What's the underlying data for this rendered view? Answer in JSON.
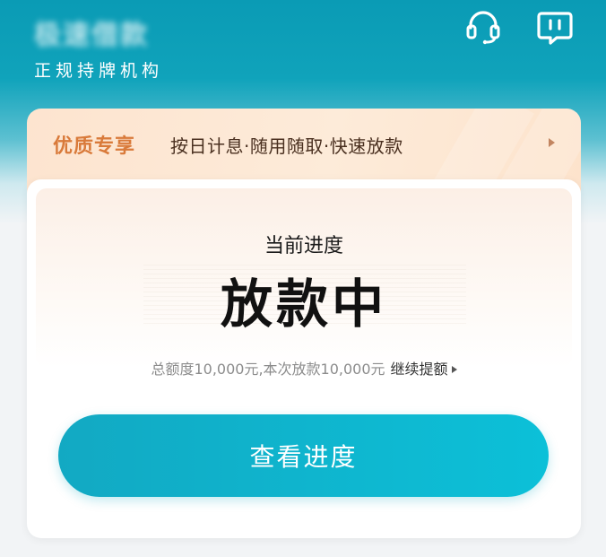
{
  "header": {
    "app_name": "极速借款",
    "subtitle": "正规持牌机构",
    "support_icon": "headset-icon",
    "message_icon": "message-icon"
  },
  "promo": {
    "title": "优质专享",
    "description": "按日计息·随用随取·快速放款"
  },
  "progress": {
    "label": "当前进度",
    "status": "放款中",
    "amount_text": "总额度10,000元,本次放款10,000元",
    "continue_link": "继续提额",
    "button_label": "查看进度"
  },
  "colors": {
    "header_bg": "#0a9bb5",
    "promo_title": "#d97a3a",
    "button_accent": "#0cc0d8"
  }
}
